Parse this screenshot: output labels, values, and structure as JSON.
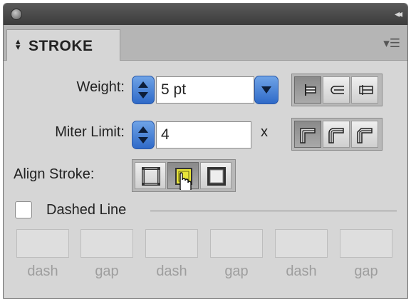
{
  "panel": {
    "tab_label": "STROKE",
    "tab_arrows_icon": "up-down-arrows-icon",
    "menu_icon": "panel-menu-icon",
    "collapse_icon": "double-chevron-icon"
  },
  "weight": {
    "label": "Weight:",
    "value": "5 pt"
  },
  "miter": {
    "label": "Miter Limit:",
    "value": "4",
    "unit": "x"
  },
  "cap_buttons": [
    "butt-cap-icon",
    "round-cap-icon",
    "projecting-cap-icon"
  ],
  "join_buttons": [
    "miter-join-icon",
    "round-join-icon",
    "bevel-join-icon"
  ],
  "align": {
    "label": "Align Stroke:",
    "buttons": [
      "align-center-icon",
      "align-inside-icon",
      "align-outside-icon"
    ],
    "selected": "align-inside-icon"
  },
  "dashed": {
    "label": "Dashed Line",
    "checked": false
  },
  "dash_fields": [
    {
      "label": "dash"
    },
    {
      "label": "gap"
    },
    {
      "label": "dash"
    },
    {
      "label": "gap"
    },
    {
      "label": "dash"
    },
    {
      "label": "gap"
    }
  ],
  "colors": {
    "accent": "#3f7bd8",
    "highlight": "#e8e43a"
  }
}
